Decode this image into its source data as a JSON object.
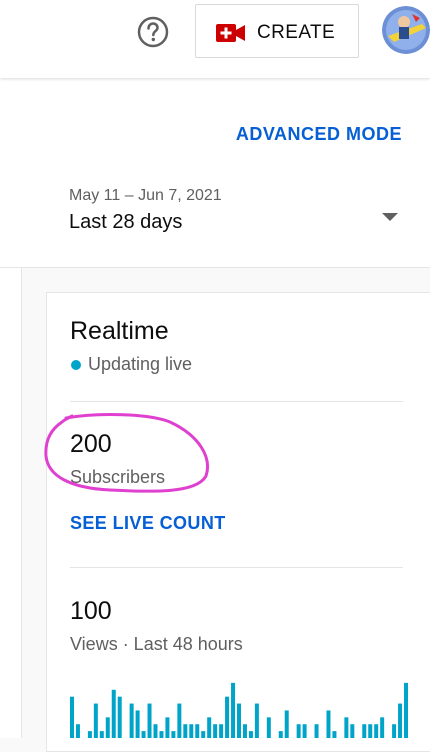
{
  "header": {
    "help_icon": "help-circle-icon",
    "create_label": "CREATE",
    "create_icon": "video-camera-plus-icon",
    "avatar_icon": "channel-avatar"
  },
  "toolbar": {
    "advanced_mode_label": "ADVANCED MODE"
  },
  "date_picker": {
    "range": "May 11 – Jun 7, 2021",
    "period": "Last 28 days"
  },
  "realtime": {
    "title": "Realtime",
    "status": "Updating live",
    "status_color": "#00a4c8",
    "subscribers": {
      "value": "200",
      "label": "Subscribers"
    },
    "live_count_link": "SEE LIVE COUNT",
    "views": {
      "value": "100",
      "label": "Views · Last 48 hours"
    }
  },
  "colors": {
    "accent": "#065fd4",
    "create_red": "#cc0000",
    "bar_color": "#00a4c8",
    "annotation_pink": "#e040d0"
  },
  "chart_data": {
    "type": "bar",
    "title": "",
    "xlabel": "",
    "ylabel": "",
    "values": [
      6,
      2,
      0,
      1,
      5,
      1,
      3,
      7,
      6,
      0,
      5,
      4,
      1,
      5,
      2,
      1,
      3,
      1,
      5,
      2,
      2,
      2,
      1,
      3,
      2,
      2,
      6,
      8,
      5,
      2,
      1,
      5,
      0,
      3,
      0,
      1,
      4,
      0,
      2,
      2,
      0,
      2,
      0,
      4,
      1,
      0,
      3,
      2,
      0,
      2,
      2,
      2,
      3,
      0,
      2,
      5,
      8
    ],
    "ylim": [
      0,
      9
    ]
  }
}
